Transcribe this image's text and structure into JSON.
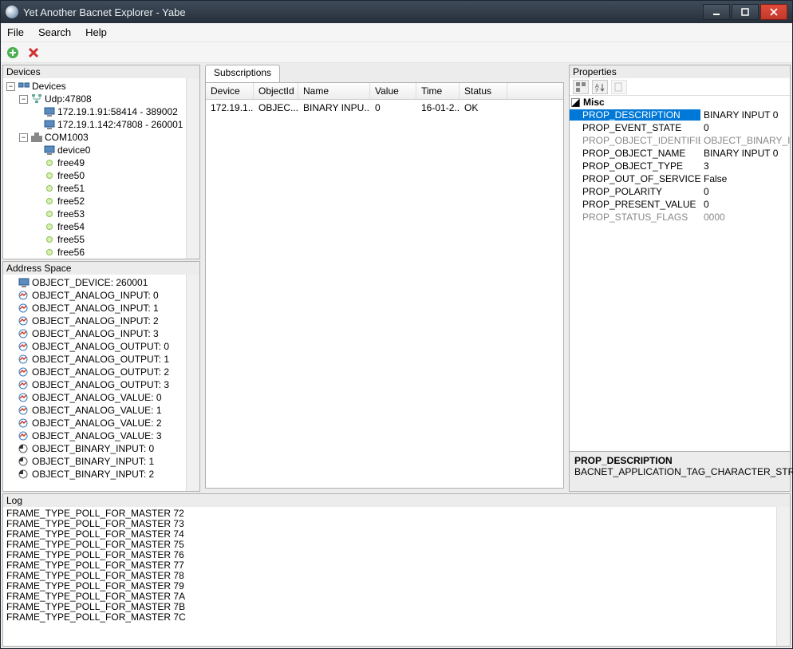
{
  "window": {
    "title": "Yet Another Bacnet Explorer - Yabe"
  },
  "menu": {
    "file": "File",
    "search": "Search",
    "help": "Help"
  },
  "panels": {
    "devices": "Devices",
    "address_space": "Address Space",
    "subscriptions": "Subscriptions",
    "properties": "Properties",
    "log": "Log"
  },
  "devices_tree": {
    "root": "Devices",
    "udp": "Udp:47808",
    "udp_children": [
      "172.19.1.91:58414 - 389002",
      "172.19.1.142:47808 - 260001"
    ],
    "com": "COM1003",
    "com_children": [
      "device0",
      "free49",
      "free50",
      "free51",
      "free52",
      "free53",
      "free54",
      "free55",
      "free56"
    ]
  },
  "address_space": [
    "OBJECT_DEVICE: 260001",
    "OBJECT_ANALOG_INPUT: 0",
    "OBJECT_ANALOG_INPUT: 1",
    "OBJECT_ANALOG_INPUT: 2",
    "OBJECT_ANALOG_INPUT: 3",
    "OBJECT_ANALOG_OUTPUT: 0",
    "OBJECT_ANALOG_OUTPUT: 1",
    "OBJECT_ANALOG_OUTPUT: 2",
    "OBJECT_ANALOG_OUTPUT: 3",
    "OBJECT_ANALOG_VALUE: 0",
    "OBJECT_ANALOG_VALUE: 1",
    "OBJECT_ANALOG_VALUE: 2",
    "OBJECT_ANALOG_VALUE: 3",
    "OBJECT_BINARY_INPUT: 0",
    "OBJECT_BINARY_INPUT: 1",
    "OBJECT_BINARY_INPUT: 2"
  ],
  "subs": {
    "headers": {
      "device": "Device",
      "objectid": "ObjectId",
      "name": "Name",
      "value": "Value",
      "time": "Time",
      "status": "Status"
    },
    "row": {
      "device": "172.19.1...",
      "objectid": "OBJEC...",
      "name": "BINARY INPU...",
      "value": "0",
      "time": "16-01-2...",
      "status": "OK"
    }
  },
  "properties": {
    "group": "Misc",
    "rows": [
      {
        "name": "PROP_DESCRIPTION",
        "value": "BINARY INPUT 0",
        "sel": true
      },
      {
        "name": "PROP_EVENT_STATE",
        "value": "0"
      },
      {
        "name": "PROP_OBJECT_IDENTIFIER",
        "value": "OBJECT_BINARY_I",
        "dis": true
      },
      {
        "name": "PROP_OBJECT_NAME",
        "value": "BINARY INPUT 0"
      },
      {
        "name": "PROP_OBJECT_TYPE",
        "value": "3"
      },
      {
        "name": "PROP_OUT_OF_SERVICE",
        "value": "False"
      },
      {
        "name": "PROP_POLARITY",
        "value": "0"
      },
      {
        "name": "PROP_PRESENT_VALUE",
        "value": "0"
      },
      {
        "name": "PROP_STATUS_FLAGS",
        "value": "0000",
        "dis": true
      }
    ],
    "desc_title": "PROP_DESCRIPTION",
    "desc_body": "BACNET_APPLICATION_TAG_CHARACTER_STRING"
  },
  "log": [
    "FRAME_TYPE_POLL_FOR_MASTER 72",
    "FRAME_TYPE_POLL_FOR_MASTER 73",
    "FRAME_TYPE_POLL_FOR_MASTER 74",
    "FRAME_TYPE_POLL_FOR_MASTER 75",
    "FRAME_TYPE_POLL_FOR_MASTER 76",
    "FRAME_TYPE_POLL_FOR_MASTER 77",
    "FRAME_TYPE_POLL_FOR_MASTER 78",
    "FRAME_TYPE_POLL_FOR_MASTER 79",
    "FRAME_TYPE_POLL_FOR_MASTER 7A",
    "FRAME_TYPE_POLL_FOR_MASTER 7B",
    "FRAME_TYPE_POLL_FOR_MASTER 7C"
  ]
}
